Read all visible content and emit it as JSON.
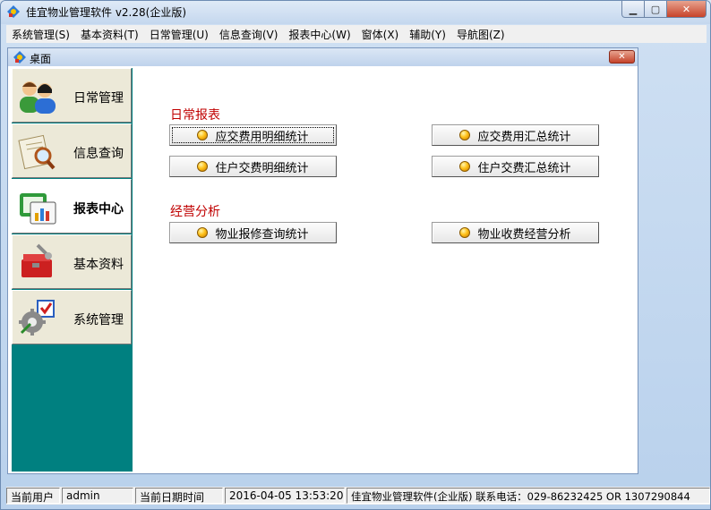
{
  "window": {
    "title": "佳宜物业管理软件 v2.28(企业版)",
    "minimize_icon": "minimize-icon",
    "maximize_icon": "maximize-icon",
    "close_icon": "close-icon"
  },
  "menubar": {
    "items": [
      {
        "label": "系统管理(S)"
      },
      {
        "label": "基本资料(T)"
      },
      {
        "label": "日常管理(U)"
      },
      {
        "label": "信息查询(V)"
      },
      {
        "label": "报表中心(W)"
      },
      {
        "label": "窗体(X)"
      },
      {
        "label": "辅助(Y)"
      },
      {
        "label": "导航图(Z)"
      }
    ]
  },
  "desktop": {
    "title": "桌面",
    "close_icon": "close-icon"
  },
  "sidebar": {
    "items": [
      {
        "label": "日常管理",
        "icon": "users-icon",
        "active": false
      },
      {
        "label": "信息查询",
        "icon": "search-document-icon",
        "active": false
      },
      {
        "label": "报表中心",
        "icon": "report-chart-icon",
        "active": true
      },
      {
        "label": "基本资料",
        "icon": "toolbox-icon",
        "active": false
      },
      {
        "label": "系统管理",
        "icon": "gear-settings-icon",
        "active": false
      }
    ]
  },
  "content": {
    "daily_reports": {
      "title": "日常报表",
      "buttons": [
        {
          "label": "应交费用明细统计"
        },
        {
          "label": "应交费用汇总统计"
        },
        {
          "label": "住户交费明细统计"
        },
        {
          "label": "住户交费汇总统计"
        }
      ]
    },
    "business_analysis": {
      "title": "经营分析",
      "buttons": [
        {
          "label": "物业报修查询统计"
        },
        {
          "label": "物业收费经营分析"
        }
      ]
    }
  },
  "statusbar": {
    "user_label": "当前用户",
    "user_value": "admin",
    "datetime_label": "当前日期时间",
    "datetime_value": "2016-04-05 13:53:20",
    "info": "佳宜物业管理软件(企业版) 联系电话：029-86232425 OR 1307290844"
  },
  "colors": {
    "sidebar_bg": "#008080",
    "section_title": "#c00000",
    "ball": "#ffc21a"
  }
}
